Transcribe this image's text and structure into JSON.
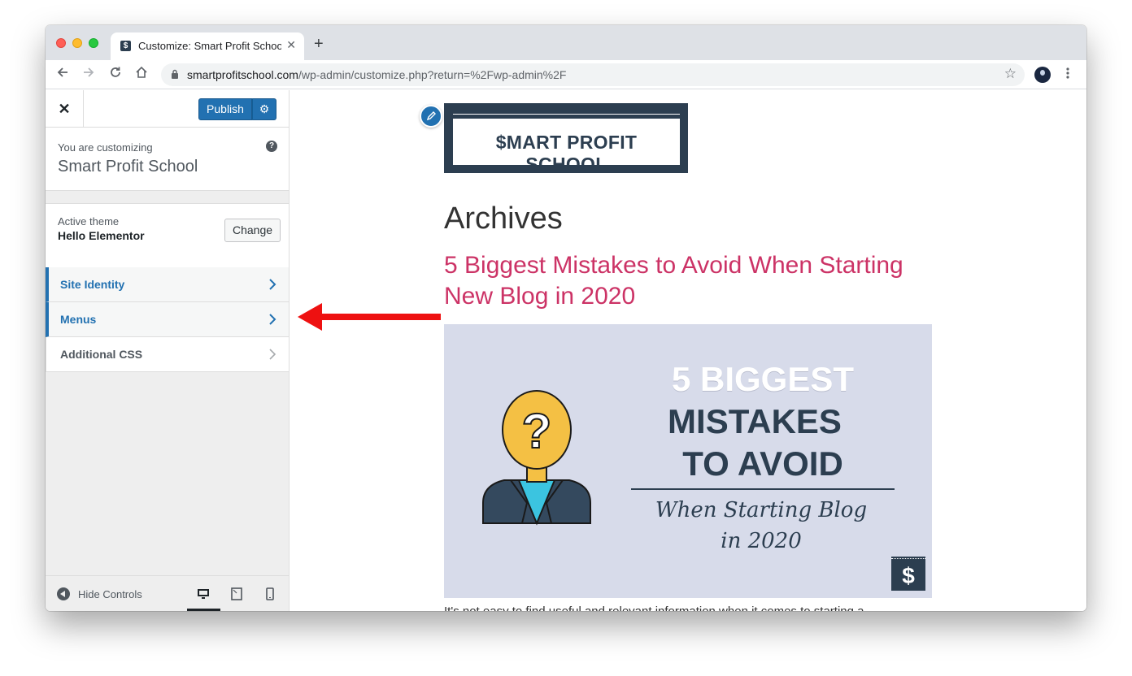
{
  "browser": {
    "tab_title": "Customize: Smart Profit School",
    "tab_favicon": "$",
    "url_host": "smartprofitschool.com",
    "url_path": "/wp-admin/customize.php?return=%2Fwp-admin%2F"
  },
  "customizer": {
    "publish_label": "Publish",
    "customizing_label": "You are customizing",
    "site_name": "Smart Profit School",
    "active_theme_label": "Active theme",
    "theme_name": "Hello Elementor",
    "change_label": "Change",
    "sections": [
      {
        "label": "Site Identity",
        "active": true
      },
      {
        "label": "Menus",
        "active": true
      },
      {
        "label": "Additional CSS",
        "active": false
      }
    ],
    "hide_controls_label": "Hide Controls",
    "colors": {
      "accent": "#2271b1",
      "link_pink": "#cc3366",
      "arrow_red": "#ee1111"
    }
  },
  "preview": {
    "logo_text": "$MART PROFIT SCHOOL",
    "archives_heading": "Archives",
    "post_title": "5 Biggest Mistakes to Avoid When Starting New Blog in 2020",
    "image": {
      "line1": "5 BIGGEST",
      "line2": "MISTAKES",
      "line3": "TO AVOID",
      "line4": "When Starting Blog",
      "line5": "in 2020",
      "badge": "$"
    },
    "excerpt": "It's not easy to find useful and relevant information when it comes to starting a"
  }
}
